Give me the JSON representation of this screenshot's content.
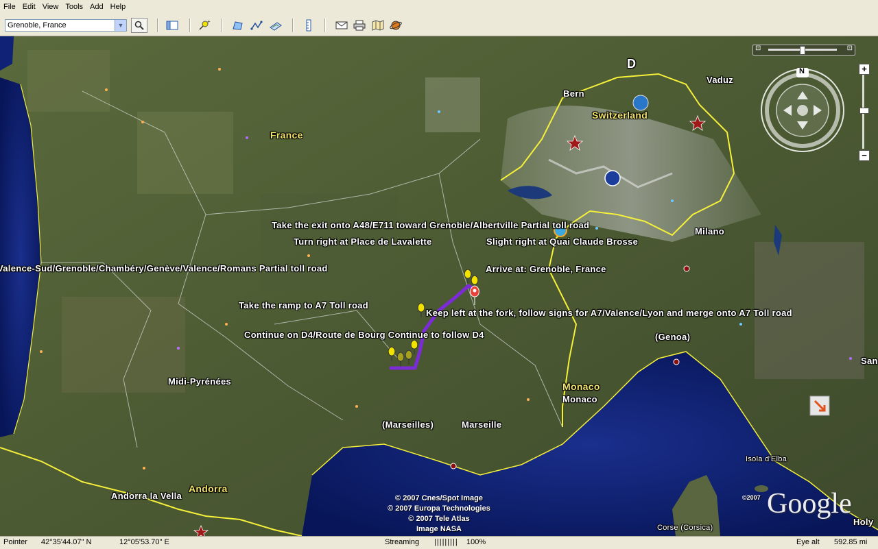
{
  "menu": [
    "File",
    "Edit",
    "View",
    "Tools",
    "Add",
    "Help"
  ],
  "search": {
    "value": "Grenoble, France"
  },
  "map": {
    "labels": {
      "france": "France",
      "switzerland": "Switzerland",
      "midi": "Midi-Pyrénées",
      "monaco_region": "Monaco",
      "andorra_region": "Andorra",
      "bern": "Bern",
      "vaduz": "Vaduz",
      "milano": "Milano",
      "genoa": "(Genoa)",
      "marseilles": "(Marseilles)",
      "marseille": "Marseille",
      "monaco": "Monaco",
      "andorra_city": "Andorra la Vella",
      "isola": "Isola d'Elba",
      "corse": "Corse (Corsica)",
      "holy": "Holy",
      "san": "San"
    },
    "directions": {
      "exit_a48": "Take the exit onto A48/E711 toward Grenoble/Albertville  Partial toll road",
      "turn_right": "Turn right at Place de Lavalette",
      "slight_right": "Slight right at Quai Claude Brosse",
      "valence_sud": "Valence-Sud/Grenoble/Chambéry/Genève/Valence/Romans  Partial toll road",
      "arrive": "Arrive at: Grenoble, France",
      "ramp_a7": "Take the ramp to A7  Toll road",
      "keep_left": "Keep left at the fork, follow signs for A7/Valence/Lyon and merge onto A7  Toll road",
      "continue_d4": "Continue on D4/Route de Bourg  Continue to follow D4"
    },
    "copyright": [
      "© 2007 Cnes/Spot Image",
      "© 2007 Europa Technologies",
      "© 2007 Tele Atlas",
      "Image NASA"
    ],
    "copyright_google": "©2007",
    "google": "Google",
    "nasa": "NASA",
    "compass_n": "N",
    "zoom_in": "+",
    "zoom_out": "−",
    "turn_badge": "TURNHERE"
  },
  "status": {
    "pointer_label": "Pointer",
    "lat": "42°35'44.07\" N",
    "lon": "12°05'53.70\" E",
    "streaming_label": "Streaming",
    "streaming_bar": "|||||||||",
    "streaming_pct": "100%",
    "eye_label": "Eye alt",
    "eye_value": "592.85 mi"
  },
  "colors": {
    "route": "#7b2cd6",
    "border": "#f5f03a",
    "sea": "#0c1e72",
    "pin_yellow": "#f2e200",
    "pin_red": "#e8413a"
  }
}
